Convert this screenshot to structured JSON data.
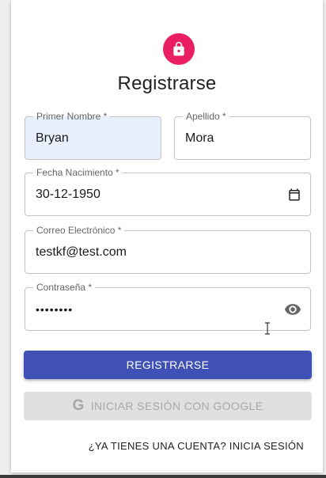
{
  "header": {
    "title": "Registrarse",
    "icon": "lock-icon"
  },
  "form": {
    "first_name": {
      "label": "Primer Nombre *",
      "value": "Bryan"
    },
    "last_name": {
      "label": "Apellido *",
      "value": "Mora"
    },
    "birth_date": {
      "label": "Fecha Nacimiento *",
      "value": "30-12-1950"
    },
    "email": {
      "label": "Correo Electrónico *",
      "value": "testkf@test.com"
    },
    "password": {
      "label": "Contraseña *",
      "value": "••••••••"
    }
  },
  "buttons": {
    "register_label": "REGISTRARSE",
    "google_label": "INICIAR SESIÓN CON GOOGLE",
    "google_icon_glyph": "G"
  },
  "links": {
    "login": "¿YA TIENES UNA CUENTA? INICIA SESIÓN"
  },
  "colors": {
    "accent": "#e91e63",
    "primary": "#3f51b5",
    "autofill": "#e8f0fe"
  }
}
